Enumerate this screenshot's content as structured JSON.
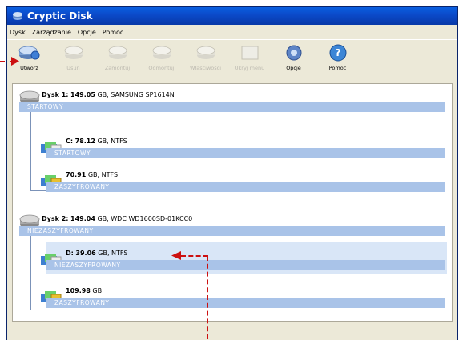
{
  "window": {
    "title": "Cryptic Disk"
  },
  "menu": [
    "Dysk",
    "Zarządzanie",
    "Opcje",
    "Pomoc"
  ],
  "toolbar": [
    {
      "label": "Utwórz",
      "enabled": true
    },
    {
      "label": "Usuń",
      "enabled": false
    },
    {
      "label": "Zamontuj",
      "enabled": false
    },
    {
      "label": "Odmontuj",
      "enabled": false
    },
    {
      "label": "Właściwości",
      "enabled": false
    },
    {
      "label": "Ukryj menu",
      "enabled": false
    },
    {
      "label": "Opcje",
      "enabled": true
    },
    {
      "label": "Pomoc",
      "enabled": true
    }
  ],
  "disks": [
    {
      "name": "Dysk 1:",
      "size": "149.05",
      "info": "GB, SAMSUNG SP1614N",
      "status": "STARTOWY",
      "partitions": [
        {
          "name": "C:",
          "size": "78.12",
          "info": "GB, NTFS",
          "status": "STARTOWY"
        },
        {
          "name": "",
          "size": "70.91",
          "info": "GB, NTFS",
          "status": "ZASZYFROWANY"
        }
      ]
    },
    {
      "name": "Dysk 2:",
      "size": "149.04",
      "info": "GB, WDC WD1600SD-01KCC0",
      "status": "NIEZASZYFROWANY",
      "partitions": [
        {
          "name": "D:",
          "size": "39.06",
          "info": "GB, NTFS",
          "status": "NIEZASZYFROWANY"
        },
        {
          "name": "",
          "size": "109.98",
          "info": "GB",
          "status": "ZASZYFROWANY"
        }
      ]
    }
  ],
  "colors": {
    "title_bar": "#0b49c8",
    "status_bar": "#a9c3e8",
    "selection": "#d9e6f7",
    "annotation": "#cc1010"
  }
}
